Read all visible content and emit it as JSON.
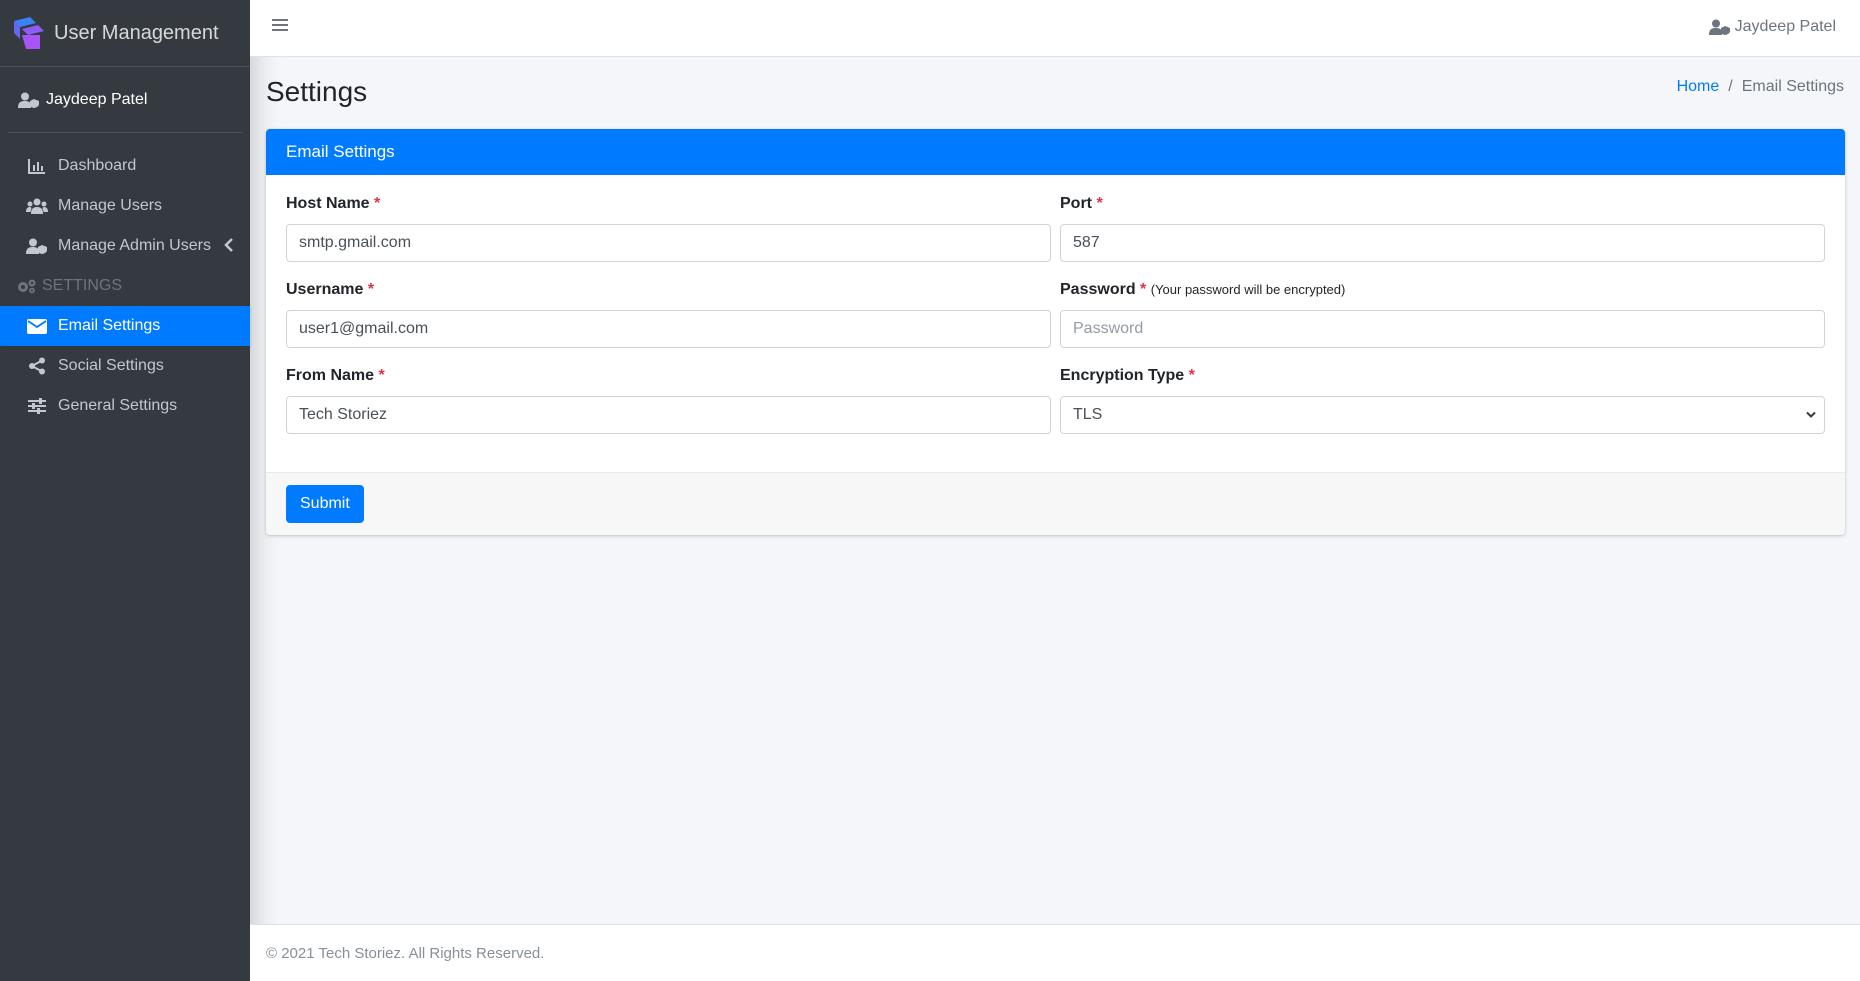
{
  "brand": {
    "title": "User Management"
  },
  "sidebar": {
    "user_name": "Jaydeep Patel",
    "items": [
      {
        "label": "Dashboard",
        "icon": "chart-icon"
      },
      {
        "label": "Manage Users",
        "icon": "users-icon"
      },
      {
        "label": "Manage Admin Users",
        "icon": "user-shield-icon"
      }
    ],
    "section_header": "Settings",
    "settings_items": [
      {
        "label": "Email Settings",
        "icon": "envelope-icon",
        "active": true
      },
      {
        "label": "Social Settings",
        "icon": "share-icon"
      },
      {
        "label": "General Settings",
        "icon": "sliders-icon"
      }
    ]
  },
  "topbar": {
    "user_name": "Jaydeep Patel"
  },
  "page": {
    "title": "Settings"
  },
  "breadcrumb": {
    "home": "Home",
    "separator": "/",
    "current": "Email Settings"
  },
  "card": {
    "title": "Email Settings",
    "fields": {
      "host_name": {
        "label": "Host Name",
        "value": "smtp.gmail.com"
      },
      "port": {
        "label": "Port",
        "value": "587"
      },
      "username": {
        "label": "Username",
        "value": "user1@gmail.com"
      },
      "password": {
        "label": "Password",
        "hint": "(Your password will be encrypted)",
        "value": "",
        "placeholder": "Password"
      },
      "from_name": {
        "label": "From Name",
        "value": "Tech Storiez"
      },
      "encryption_type": {
        "label": "Encryption Type",
        "value": "TLS"
      }
    },
    "required_mark": "*",
    "submit_label": "Submit"
  },
  "footer": {
    "text": "© 2021 Tech Storiez. All Rights Reserved."
  },
  "colors": {
    "primary": "#007bff",
    "sidebar_bg": "#343a40",
    "required": "#dc3545"
  }
}
